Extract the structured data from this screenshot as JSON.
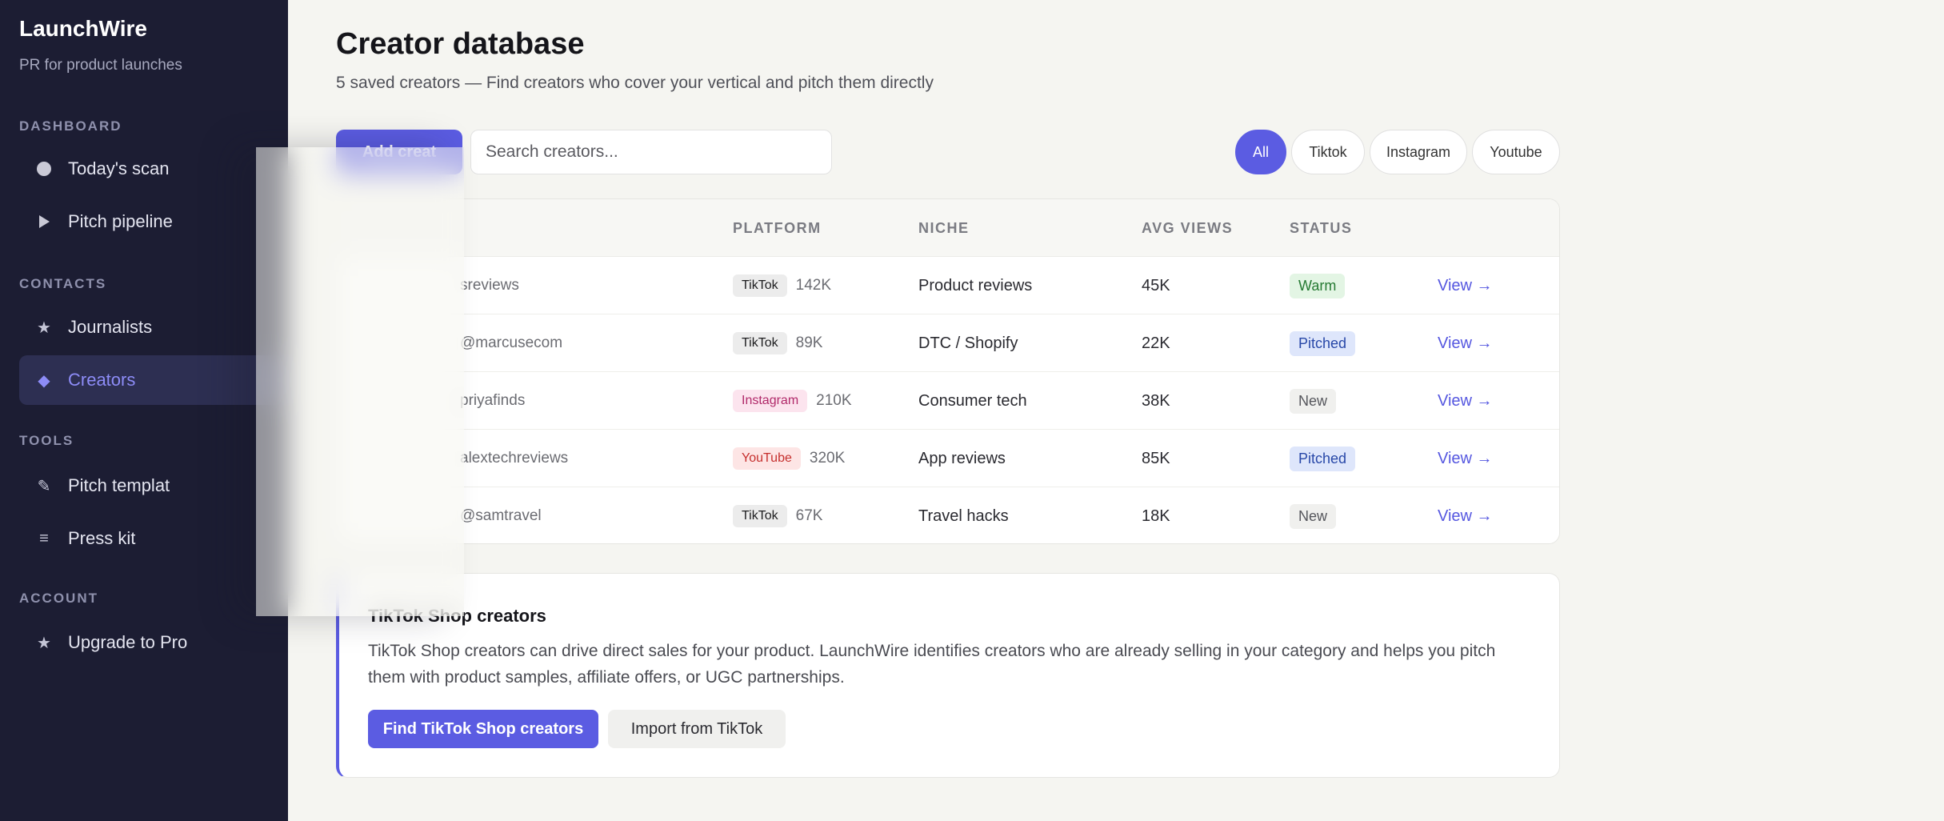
{
  "sidebar": {
    "brand": "LaunchWire",
    "tagline": "PR for product launches",
    "sections": {
      "dashboard": "DASHBOARD",
      "contacts": "CONTACTS",
      "tools": "TOOLS",
      "account": "ACCOUNT"
    },
    "items": {
      "todays_scan": "Today's scan",
      "pitch_pipeline": "Pitch pipeline",
      "journalists": "Journalists",
      "creators": "Creators",
      "pitch_templates": "Pitch templat",
      "press_kit": "Press kit",
      "upgrade": "Upgrade to Pro"
    },
    "active_item": "creators"
  },
  "header": {
    "title": "Creator database",
    "subtitle": "5 saved creators — Find creators who cover your vertical and pitch them directly"
  },
  "toolbar": {
    "add_label": "Add creat",
    "search_placeholder": "Search creators...",
    "filters": [
      "All",
      "Tiktok",
      "Instagram",
      "Youtube"
    ],
    "active_filter": "All"
  },
  "table": {
    "columns": [
      "PLATFORM",
      "NICHE",
      "AVG VIEWS",
      "STATUS"
    ],
    "rows": [
      {
        "handle": "sreviews",
        "platform": "TikTok",
        "followers": "142K",
        "niche": "Product reviews",
        "avg_views": "45K",
        "status": "Warm",
        "action": "View →"
      },
      {
        "handle": "@marcusecom",
        "platform": "TikTok",
        "followers": "89K",
        "niche": "DTC / Shopify",
        "avg_views": "22K",
        "status": "Pitched",
        "action": "View →"
      },
      {
        "handle": "priyafinds",
        "platform": "Instagram",
        "followers": "210K",
        "niche": "Consumer tech",
        "avg_views": "38K",
        "status": "New",
        "action": "View →"
      },
      {
        "handle": "alextechreviews",
        "platform": "YouTube",
        "followers": "320K",
        "niche": "App reviews",
        "avg_views": "85K",
        "status": "Pitched",
        "action": "View →"
      },
      {
        "handle": "@samtravel",
        "platform": "TikTok",
        "followers": "67K",
        "niche": "Travel hacks",
        "avg_views": "18K",
        "status": "New",
        "action": "View →"
      }
    ]
  },
  "card": {
    "title": "TikTok Shop creators",
    "body": "TikTok Shop creators can drive direct sales for your product. LaunchWire identifies creators who are already selling in your category and helps you pitch them with product samples, affiliate offers, or UGC partnerships.",
    "primary_label": "Find TikTok Shop creators",
    "secondary_label": "Import from TikTok"
  },
  "colors": {
    "accent": "#5b5ce2",
    "sidebar_bg": "#1c1d33"
  }
}
